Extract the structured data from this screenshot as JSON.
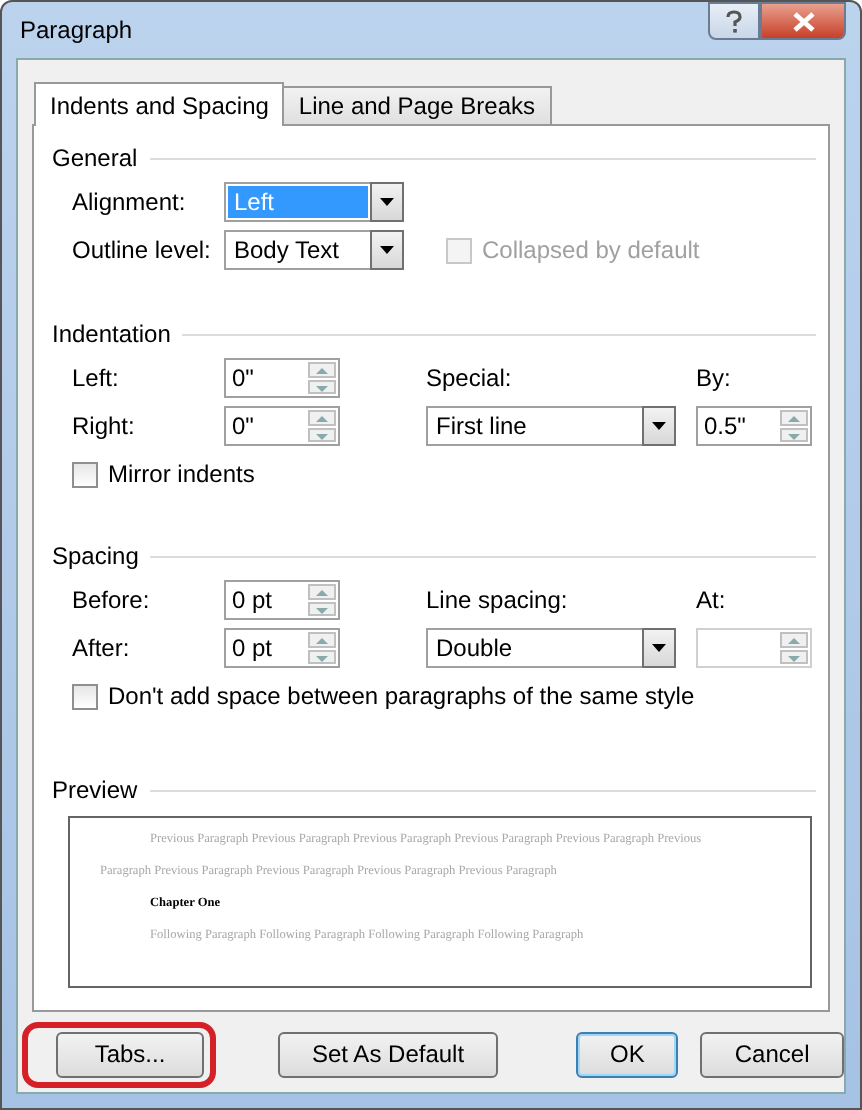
{
  "window": {
    "title": "Paragraph"
  },
  "tabs": [
    {
      "label": "Indents and Spacing",
      "selected": true
    },
    {
      "label": "Line and Page Breaks",
      "selected": false
    }
  ],
  "general": {
    "heading": "General",
    "alignment": {
      "label": "Alignment:",
      "value": "Left",
      "highlighted": true
    },
    "outline_level": {
      "label": "Outline level:",
      "value": "Body Text",
      "highlighted": false
    },
    "collapsed": {
      "label": "Collapsed by default",
      "checked": false,
      "disabled": true
    }
  },
  "indentation": {
    "heading": "Indentation",
    "left": {
      "label": "Left:",
      "value": "0\""
    },
    "right": {
      "label": "Right:",
      "value": "0\""
    },
    "special": {
      "label": "Special:",
      "value": "First line",
      "highlighted": false
    },
    "by": {
      "label": "By:",
      "value": "0.5\""
    },
    "mirror": {
      "label": "Mirror indents",
      "checked": false,
      "disabled": false
    }
  },
  "spacing": {
    "heading": "Spacing",
    "before": {
      "label": "Before:",
      "value": "0 pt"
    },
    "after": {
      "label": "After:",
      "value": "0 pt"
    },
    "line_spacing": {
      "label": "Line spacing:",
      "value": "Double",
      "highlighted": false
    },
    "at": {
      "label": "At:",
      "disabled": true
    },
    "dont_add": {
      "label": "Don't add space between paragraphs of the same style",
      "checked": false,
      "disabled": false
    }
  },
  "preview": {
    "heading": "Preview",
    "previous": "Previous Paragraph Previous Paragraph Previous Paragraph Previous Paragraph Previous Paragraph Previous Paragraph Previous Paragraph Previous Paragraph Previous Paragraph Previous Paragraph",
    "current": "Chapter One",
    "following": "Following Paragraph Following Paragraph Following Paragraph Following Paragraph"
  },
  "buttons": [
    {
      "label": "Tabs...",
      "default": false,
      "annotated": true
    },
    {
      "label": "Set As Default",
      "default": false,
      "annotated": false
    },
    {
      "label": "OK",
      "default": true,
      "annotated": false
    },
    {
      "label": "Cancel",
      "default": false,
      "annotated": false
    }
  ]
}
